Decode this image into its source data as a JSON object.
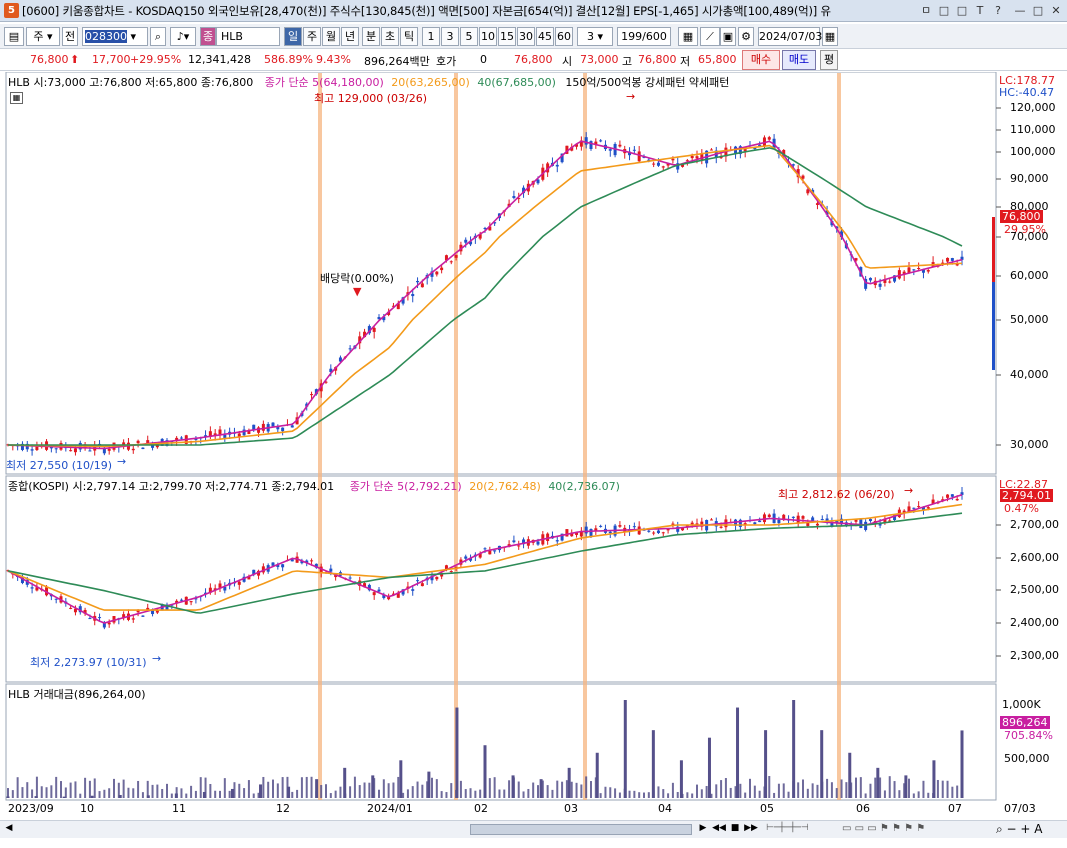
{
  "titlebar": {
    "app_number": "5",
    "title": "[0600] 키움종합차트 - KOSDAQ150 외국인보유[28,470(천)] 주식수[130,845(천)] 액면[500] 자본금[654(억)] 결산[12월] EPS[-1,465] 시가총액[100,489(억)] 유",
    "controls": [
      "ㅁ",
      "□",
      "□",
      "T",
      "?",
      "—",
      "□",
      "✕"
    ]
  },
  "toolbar": {
    "market": "주",
    "all_label": "전",
    "code": "028300",
    "stock_type": "종",
    "stock_name": "HLB",
    "periods": [
      "일",
      "주",
      "월",
      "년",
      "분",
      "초",
      "틱"
    ],
    "active_period": "일",
    "intervals": [
      "1",
      "3",
      "5",
      "10",
      "15",
      "30",
      "45",
      "60"
    ],
    "count_select": "3",
    "display_count": "199",
    "display_total": "/600",
    "date": "2024/07/03"
  },
  "quote": {
    "price": "76,800",
    "change": "17,700",
    "change_pct": "+29.95%",
    "volume": "12,341,428",
    "vol_ratio": "586.89%",
    "turnover": "9.43%",
    "amount": "896,264백만",
    "hoga_label": "호가",
    "hoga_value": "0",
    "hoga_price": "76,800",
    "open_label": "시",
    "open": "73,000",
    "high_label": "고",
    "high": "76,800",
    "low_label": "저",
    "low": "65,800",
    "buy": "매수",
    "sell": "매도",
    "avg": "평"
  },
  "panel_price": {
    "legend_main": "HLB 시:73,000 고:76,800 저:65,800 종:76,800",
    "legend_ma_label": "종가 단순 5(64,180,00)",
    "legend_ma20": "20(63,265,00)",
    "legend_ma40": "40(67,685,00)",
    "legend_pattern": "150억/500억봉 강세패턴  약세패턴",
    "lc": "LC:178.77",
    "hc": "HC:-40.47",
    "high_marker": "최고 129,000 (03/26)",
    "low_marker": "최저 27,550 (10/19)",
    "dividend": "배당락(0.00%)",
    "last_price": "76,800",
    "last_pct": "29.95%",
    "y_ticks": [
      "120,000",
      "110,000",
      "100,000",
      "90,000",
      "80,000",
      "70,000",
      "60,000",
      "50,000",
      "40,000",
      "30,000"
    ]
  },
  "panel_kospi": {
    "legend_main": "종합(KOSPI) 시:2,797.14 고:2,799.70 저:2,774.71 종:2,794.01",
    "legend_ma_label": "종가 단순 5(2,792.21)",
    "legend_ma20": "20(2,762.48)",
    "legend_ma40": "40(2,736.07)",
    "lc": "LC:22.87",
    "high_marker": "최고 2,812.62 (06/20)",
    "low_marker": "최저 2,273.97 (10/31)",
    "last_value": "2,794.01",
    "last_pct": "0.47%",
    "y_ticks": [
      "2,700,00",
      "2,600,00",
      "2,500,00",
      "2,400,00",
      "2,300,00"
    ]
  },
  "panel_volume": {
    "legend": "HLB 거래대금(896,264,00)",
    "unit_label": "1,000K",
    "last_value": "896,264",
    "last_pct": "705.84%",
    "y_ticks": [
      "500,000"
    ]
  },
  "x_axis": [
    "2023/09",
    "10",
    "11",
    "12",
    "2024/01",
    "02",
    "03",
    "04",
    "05",
    "06",
    "07",
    "07/03"
  ],
  "colors": {
    "ma5": "#c81ea0",
    "ma20": "#f39a1a",
    "ma40": "#2e8b57",
    "up": "#e0191f",
    "down": "#1f50c8",
    "volume": "#55508a",
    "highlight": "#f6b47f"
  },
  "chart_data": [
    {
      "type": "candlestick",
      "title": "HLB",
      "ylim": [
        25000,
        130000
      ],
      "series": [
        {
          "name": "종가 단순 5",
          "x": [
            "2023/09",
            "2023/10",
            "2023/11",
            "2023/12",
            "2024/01",
            "2024/02",
            "2024/03",
            "2024/04",
            "2024/05",
            "2024/06",
            "2024/07"
          ],
          "values": [
            30000,
            29500,
            31000,
            33000,
            52000,
            72000,
            105000,
            95000,
            105000,
            58000,
            64180
          ]
        },
        {
          "name": "20",
          "x": [
            "2023/09",
            "2023/10",
            "2023/11",
            "2023/12",
            "2024/01",
            "2024/02",
            "2024/03",
            "2024/04",
            "2024/05",
            "2024/06",
            "2024/07"
          ],
          "values": [
            30000,
            29800,
            30500,
            32000,
            45000,
            66000,
            93000,
            98000,
            103000,
            62000,
            63265
          ]
        },
        {
          "name": "40",
          "x": [
            "2023/09",
            "2023/10",
            "2023/11",
            "2023/12",
            "2024/01",
            "2024/02",
            "2024/03",
            "2024/04",
            "2024/05",
            "2024/06",
            "2024/07"
          ],
          "values": [
            30000,
            30000,
            30000,
            31000,
            40000,
            55000,
            80000,
            95000,
            102000,
            80000,
            67685
          ]
        }
      ]
    },
    {
      "type": "candlestick",
      "title": "종합(KOSPI)",
      "ylim": [
        2250,
        2850
      ],
      "series": [
        {
          "name": "종가 단순 5",
          "x": [
            "2023/09",
            "2023/10",
            "2023/11",
            "2023/12",
            "2024/01",
            "2024/02",
            "2024/03",
            "2024/04",
            "2024/05",
            "2024/06",
            "2024/07"
          ],
          "values": [
            2560,
            2400,
            2480,
            2600,
            2480,
            2620,
            2680,
            2690,
            2720,
            2700,
            2792.21
          ]
        },
        {
          "name": "20",
          "x": [
            "2023/09",
            "2023/10",
            "2023/11",
            "2023/12",
            "2024/01",
            "2024/02",
            "2024/03",
            "2024/04",
            "2024/05",
            "2024/06",
            "2024/07"
          ],
          "values": [
            2560,
            2440,
            2440,
            2560,
            2540,
            2580,
            2660,
            2700,
            2700,
            2720,
            2762.48
          ]
        },
        {
          "name": "40",
          "x": [
            "2023/09",
            "2023/10",
            "2023/11",
            "2023/12",
            "2024/01",
            "2024/02",
            "2024/03",
            "2024/04",
            "2024/05",
            "2024/06",
            "2024/07"
          ],
          "values": [
            2560,
            2500,
            2430,
            2490,
            2540,
            2560,
            2620,
            2670,
            2690,
            2700,
            2736.07
          ]
        }
      ]
    },
    {
      "type": "bar",
      "title": "HLB 거래대금",
      "values": [
        20000,
        25000,
        18000,
        30000,
        40000,
        35000,
        60000,
        80000,
        120000,
        180000,
        150000,
        250000,
        400000,
        300000,
        500000,
        350000,
        1200000,
        700000,
        300000,
        250000,
        400000,
        600000,
        1300000,
        900000,
        500000,
        800000,
        1200000,
        900000,
        1300000,
        900000,
        600000,
        400000,
        300000,
        500000,
        896264
      ],
      "ylim": [
        0,
        1300000
      ]
    }
  ]
}
